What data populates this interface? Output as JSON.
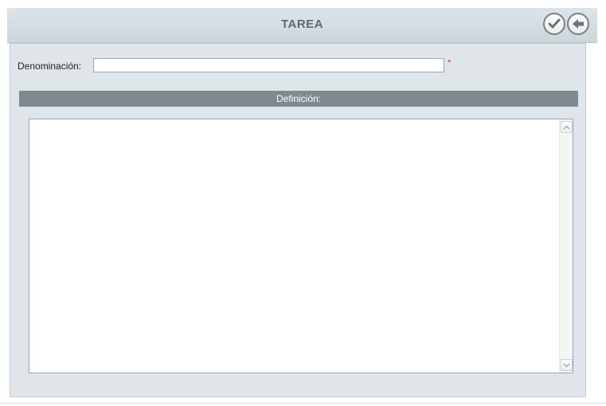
{
  "window": {
    "title": "TAREA",
    "accept_icon": "checkmark-circle-icon",
    "back_icon": "arrow-left-circle-icon"
  },
  "form": {
    "name_label": "Denominación:",
    "name_value": "",
    "required_mark": "*",
    "definition_header": "Definición:",
    "definition_value": ""
  },
  "colors": {
    "titlebar": "#ccd6dc",
    "panel": "#dfe5e8",
    "section_header": "#7e8a8f",
    "required": "#d93030"
  }
}
